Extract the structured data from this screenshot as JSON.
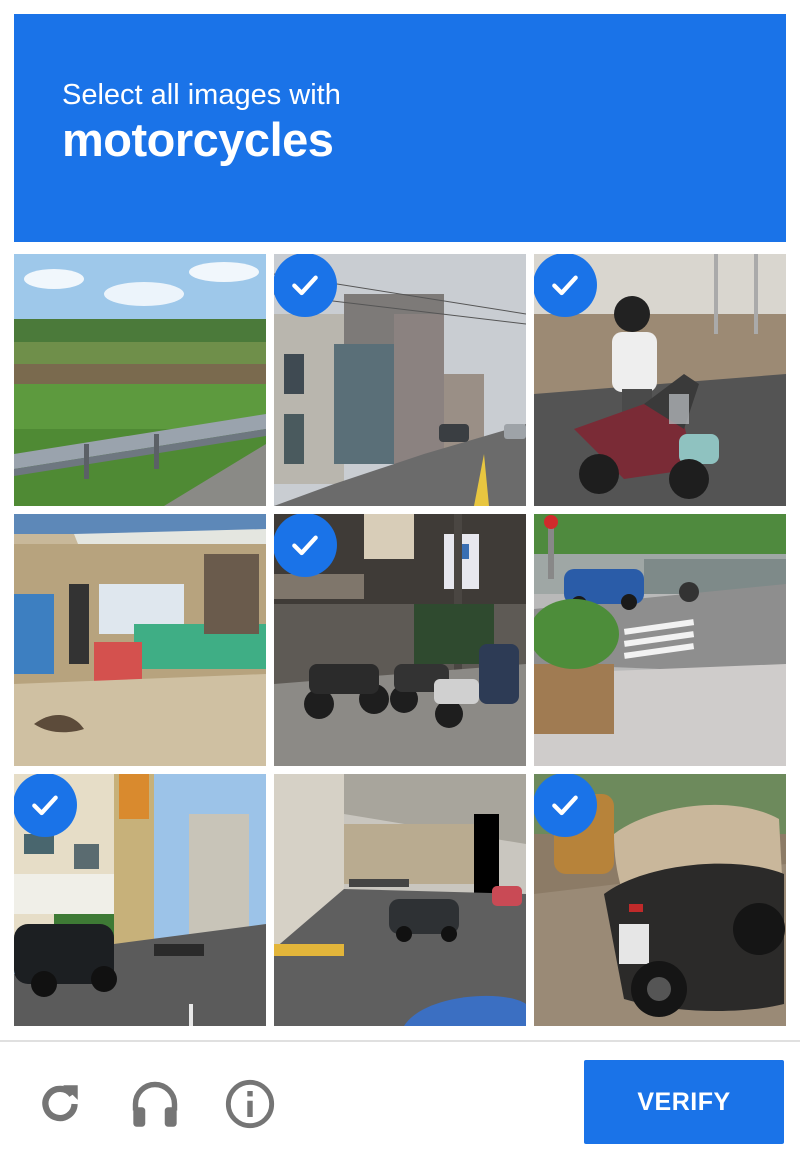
{
  "header": {
    "instruction": "Select all images with",
    "target": "motorcycles"
  },
  "tiles": [
    {
      "scene": "field-with-guardrail",
      "selected": false
    },
    {
      "scene": "narrow-street-buildings",
      "selected": true
    },
    {
      "scene": "person-on-scooter",
      "selected": true
    },
    {
      "scene": "roadside-shop",
      "selected": false
    },
    {
      "scene": "parked-motorcycles-storefront",
      "selected": true
    },
    {
      "scene": "crosswalk-planter-car",
      "selected": false
    },
    {
      "scene": "street-with-black-car",
      "selected": true
    },
    {
      "scene": "road-under-overpass",
      "selected": false
    },
    {
      "scene": "scooter-closeup",
      "selected": true
    }
  ],
  "footer": {
    "reload_icon": "reload-icon",
    "audio_icon": "headphones-icon",
    "info_icon": "info-icon",
    "verify_label": "VERIFY"
  },
  "colors": {
    "accent": "#1a73e8",
    "icon_gray": "#757575"
  }
}
